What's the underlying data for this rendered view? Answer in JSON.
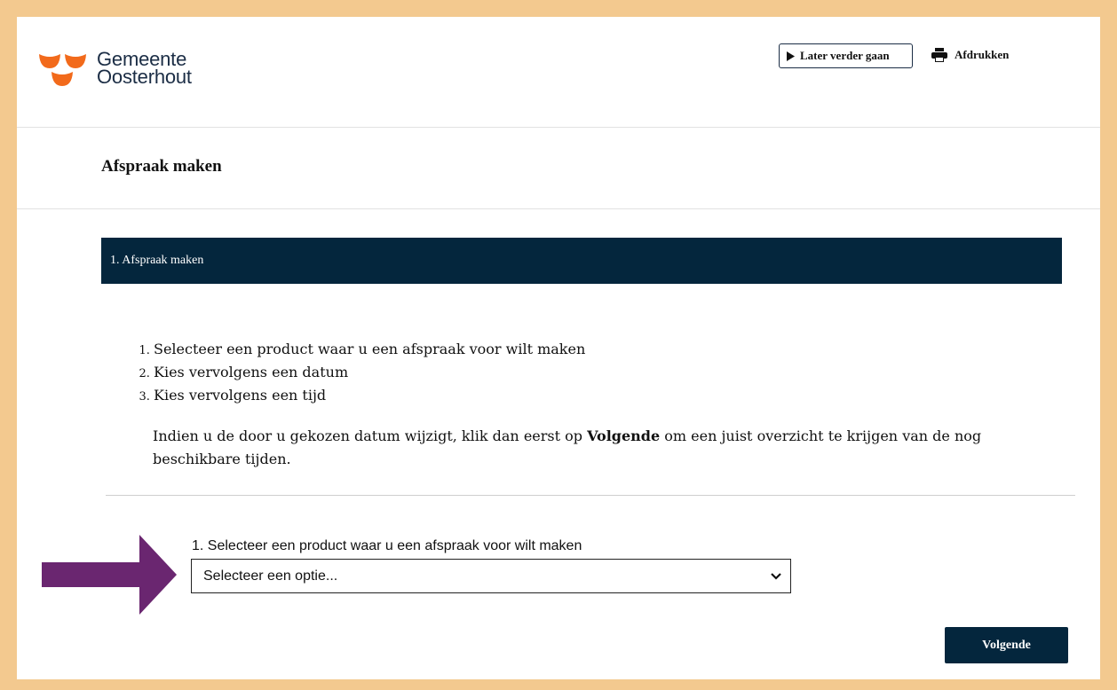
{
  "header": {
    "logo_line1": "Gemeente",
    "logo_line2": "Oosterhout",
    "later_label": "Later verder gaan",
    "print_label": "Afdrukken"
  },
  "page": {
    "title": "Afspraak maken",
    "step_bar": "1. Afspraak maken"
  },
  "instructions": [
    "Selecteer een product waar u een afspraak voor wilt maken",
    "Kies vervolgens een datum",
    "Kies vervolgens een tijd"
  ],
  "note": {
    "before": "Indien u de door u gekozen datum wijzigt, klik dan eerst op ",
    "bold": "Volgende",
    "after": " om een juist overzicht te krijgen van de nog beschikbare tijden."
  },
  "form": {
    "product_label": "1. Selecteer een product waar u een afspraak voor wilt maken",
    "product_select_value": "Selecteer een optie..."
  },
  "buttons": {
    "next": "Volgende"
  },
  "colors": {
    "frame": "#f3c98f",
    "navy": "#04263d",
    "logo_orange": "#f26a1b",
    "arrow_purple": "#6a2670"
  },
  "icons": {
    "later": "play-triangle-icon",
    "print": "printer-icon",
    "select": "chevron-down-icon",
    "annotation": "arrow-right-icon"
  }
}
